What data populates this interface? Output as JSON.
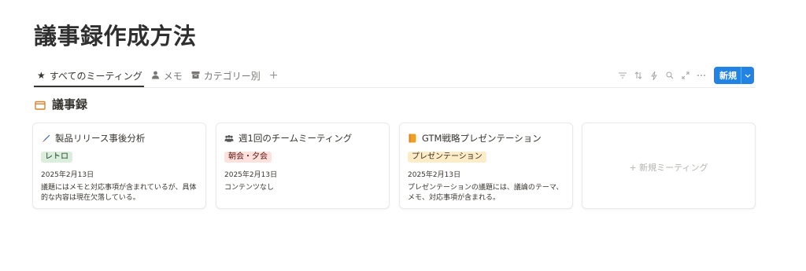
{
  "page": {
    "title": "議事録作成方法"
  },
  "tabs": [
    {
      "label": "すべてのミーティング",
      "icon": "star-icon"
    },
    {
      "label": "メモ",
      "icon": "person-icon"
    },
    {
      "label": "カテゴリー別",
      "icon": "archive-icon"
    }
  ],
  "tab_add": "+",
  "toolbar": {
    "icons": [
      "filter-icon",
      "sort-icon",
      "automation-icon",
      "search-icon",
      "expand-icon",
      "more-icon"
    ],
    "new_label": "新規"
  },
  "section": {
    "title": "議事録",
    "icon": "folder-icon",
    "icon_color": "#d9822b"
  },
  "cards": [
    {
      "title": "製品リリース事後分析",
      "icon": "pencil-icon",
      "tag": "レトロ",
      "tag_bg": "#dbeddb",
      "tag_color": "#1c3829",
      "date": "2025年2月13日",
      "desc": "議題にはメモと対応事項が含まれているが、具体的な内容は現在欠落している。"
    },
    {
      "title": "週1回のチームミーティング",
      "icon": "people-icon",
      "tag": "朝会・夕会",
      "tag_bg": "#ffe2dd",
      "tag_color": "#5d1715",
      "date": "2025年2月13日",
      "desc": "コンテンツなし"
    },
    {
      "title": "GTM戦略プレゼンテーション",
      "icon": "notebook-icon",
      "tag": "プレゼンテーション",
      "tag_bg": "#fdecc8",
      "tag_color": "#402c1b",
      "date": "2025年2月13日",
      "desc": "プレゼンテーションの議題には、議論のテーマ、メモ、対応事項が含まれる。"
    }
  ],
  "new_card": {
    "label": "+ 新規ミーティング"
  }
}
